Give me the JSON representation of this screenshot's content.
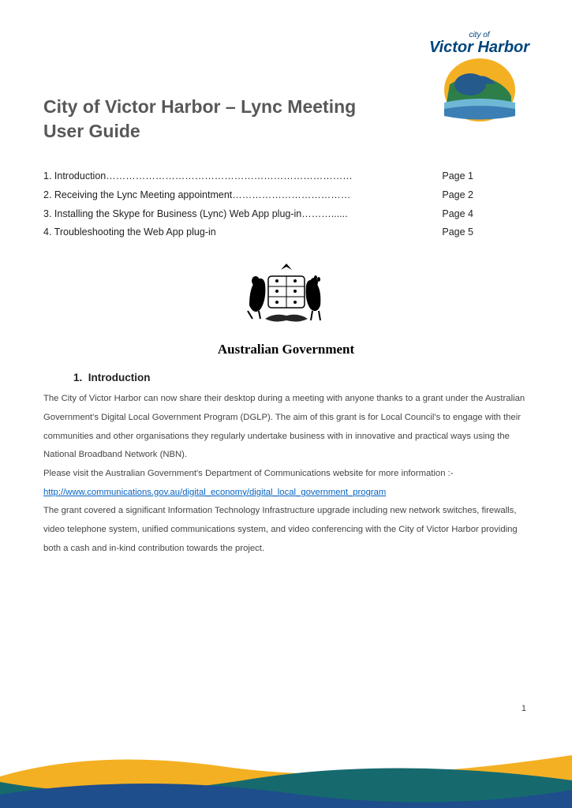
{
  "logo": {
    "prefix": "city of",
    "name": "Victor Harbor"
  },
  "title": "City of Victor Harbor – Lync Meeting User Guide",
  "toc": [
    {
      "label": "1.  Introduction…………………………………………………………………",
      "page": "Page  1"
    },
    {
      "label": "2.  Receiving the Lync Meeting appointment………………………………",
      "page": "Page  2"
    },
    {
      "label": "3.  Installing the Skype for Business (Lync) Web App plug-in………......",
      "page": "Page  4"
    },
    {
      "label": "4.  Troubleshooting the Web App plug-in",
      "page": "Page  5"
    }
  ],
  "crest_label": "Australian Government",
  "section": {
    "number": "1.",
    "title": "Introduction"
  },
  "para1": "The City of Victor Harbor can now share their desktop during a meeting with anyone thanks to a grant under the Australian Government's Digital Local Government Program (DGLP).   The aim of this grant is for Local Council's to engage with their communities and other organisations they regularly undertake business with in innovative and practical ways using the National Broadband Network (NBN).",
  "para2_prefix": "Please visit the Australian Government's Department of Communications website for more information :-",
  "link_text": "http://www.communications.gov.au/digital_economy/digital_local_government_program",
  "para3": "The grant covered a significant Information Technology Infrastructure upgrade including new network switches, firewalls, video telephone system, unified communications system, and video conferencing with the City of Victor Harbor providing both a cash and in-kind contribution towards the project.",
  "page_number": "1"
}
